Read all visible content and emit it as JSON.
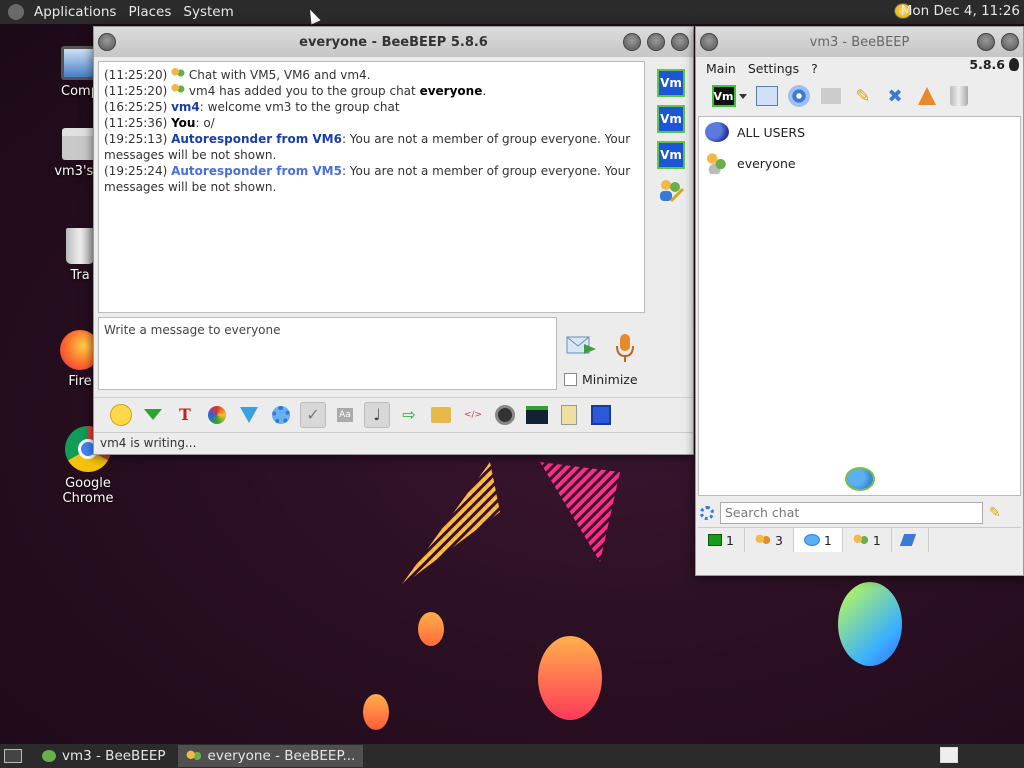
{
  "top_panel": {
    "menus": [
      "Applications",
      "Places",
      "System"
    ],
    "clock": "Mon Dec  4, 11:26"
  },
  "desktop": {
    "icons": [
      {
        "label": "Comp",
        "icon": "computer-icon"
      },
      {
        "label": "vm3's h",
        "icon": "home-folder-icon"
      },
      {
        "label": "Tra",
        "icon": "trash-icon"
      },
      {
        "label": "Fire",
        "icon": "firefox-icon"
      },
      {
        "label": "Google Chrome",
        "icon": "chrome-icon"
      }
    ]
  },
  "chat_window": {
    "title": "everyone - BeeBEEP 5.8.6",
    "log": [
      {
        "time": "(11:25:20)",
        "text": " Chat with VM5, VM6 and vm4."
      },
      {
        "time": "(11:25:20)",
        "text": " vm4 has added you to the group chat ",
        "bold": "everyone",
        "after": "."
      },
      {
        "time": "(16:25:25)",
        "name": "vm4",
        "text": ": welcome vm3 to the group chat"
      },
      {
        "time": "(11:25:36)",
        "name": "You",
        "text": ": o/"
      },
      {
        "time": "(19:25:13)",
        "name": "Autoresponder from VM6",
        "text": ": You are not a member of group everyone. Your messages will be not shown."
      },
      {
        "time": "(19:25:24)",
        "name": "Autoresponder from VM5",
        "text": ": You are not a member of group everyone. Your messages will be not shown."
      }
    ],
    "message_placeholder": "Write a message to everyone",
    "minimize_label": "Minimize",
    "members": [
      "Vm",
      "Vm",
      "Vm"
    ],
    "status": "vm4 is writing..."
  },
  "main_window": {
    "title": "vm3 - BeeBEEP",
    "menus": [
      "Main",
      "Settings",
      "?"
    ],
    "version": "5.8.6",
    "status_icon": "Vm",
    "chats": [
      {
        "label": "ALL USERS",
        "icon": "chat-bubbles-icon"
      },
      {
        "label": "everyone",
        "icon": "group-icon"
      }
    ],
    "search_placeholder": "Search chat",
    "tabs": [
      {
        "count": "1",
        "icon": "users-tab-icon"
      },
      {
        "count": "3",
        "icon": "groups-tab-icon"
      },
      {
        "count": "1",
        "icon": "chats-tab-icon",
        "selected": true
      },
      {
        "count": "1",
        "icon": "shares-tab-icon"
      },
      {
        "count": "",
        "icon": "tools-tab-icon"
      }
    ]
  },
  "bottom_panel": {
    "tasks": [
      {
        "label": "vm3 - BeeBEEP"
      },
      {
        "label": "everyone - BeeBEEP...",
        "active": true
      }
    ]
  },
  "colors": {
    "accent": "#1c56d6",
    "name_link": "#1a3ea8",
    "panel": "#2b2b2b"
  }
}
